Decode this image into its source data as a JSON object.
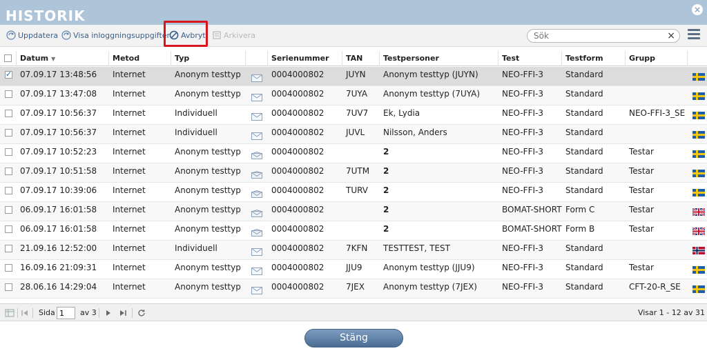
{
  "window": {
    "title": "HISTORIK"
  },
  "toolbar": {
    "update": "Uppdatera",
    "show_login": "Visa inloggningsuppgifter",
    "cancel": "Avbryt",
    "archive": "Arkivera",
    "search_placeholder": "Sök"
  },
  "table": {
    "columns": [
      "Datum",
      "Metod",
      "Typ",
      "",
      "Serienummer",
      "TAN",
      "Testpersoner",
      "Test",
      "Testform",
      "Grupp"
    ],
    "rows": [
      {
        "datum": "07.09.17 13:48:56",
        "metod": "Internet",
        "typ": "Anonym testtyp",
        "serie": "0004000802",
        "tan": "JUYN",
        "person": "Anonym testtyp (JUYN)",
        "test": "NEO-FFI-3",
        "form": "Standard",
        "grupp": "",
        "flag": "se",
        "checked": true
      },
      {
        "datum": "07.09.17 13:47:08",
        "metod": "Internet",
        "typ": "Anonym testtyp",
        "serie": "0004000802",
        "tan": "7UYA",
        "person": "Anonym testtyp (7UYA)",
        "test": "NEO-FFI-3",
        "form": "Standard",
        "grupp": "",
        "flag": "se"
      },
      {
        "datum": "07.09.17 10:56:37",
        "metod": "Internet",
        "typ": "Individuell",
        "serie": "0004000802",
        "tan": "7UV7",
        "person": "Ek, Lydia",
        "test": "NEO-FFI-3",
        "form": "Standard",
        "grupp": "NEO-FFI-3_SE",
        "flag": "se"
      },
      {
        "datum": "07.09.17 10:56:37",
        "metod": "Internet",
        "typ": "Individuell",
        "serie": "0004000802",
        "tan": "JUVL",
        "person": "Nilsson, Anders",
        "test": "NEO-FFI-3",
        "form": "Standard",
        "grupp": "",
        "flag": "se"
      },
      {
        "datum": "07.09.17 10:52:23",
        "metod": "Internet",
        "typ": "Anonym testtyp",
        "serie": "0004000802",
        "tan": "",
        "person": "2",
        "test": "NEO-FFI-3",
        "form": "Standard",
        "grupp": "Testar",
        "flag": "se"
      },
      {
        "datum": "07.09.17 10:51:58",
        "metod": "Internet",
        "typ": "Anonym testtyp",
        "serie": "0004000802",
        "tan": "7UTM",
        "person": "2",
        "test": "NEO-FFI-3",
        "form": "Standard",
        "grupp": "Testar",
        "flag": "se"
      },
      {
        "datum": "07.09.17 10:39:06",
        "metod": "Internet",
        "typ": "Anonym testtyp",
        "serie": "0004000802",
        "tan": "TURV",
        "person": "2",
        "test": "NEO-FFI-3",
        "form": "Standard",
        "grupp": "Testar",
        "flag": "se"
      },
      {
        "datum": "06.09.17 16:01:58",
        "metod": "Internet",
        "typ": "Anonym testtyp",
        "serie": "0004000802",
        "tan": "",
        "person": "2",
        "test": "BOMAT-SHORT",
        "form": "Form C",
        "grupp": "Testar",
        "flag": "uk"
      },
      {
        "datum": "06.09.17 16:01:58",
        "metod": "Internet",
        "typ": "Anonym testtyp",
        "serie": "0004000802",
        "tan": "",
        "person": "2",
        "test": "BOMAT-SHORT",
        "form": "Form B",
        "grupp": "Testar",
        "flag": "uk"
      },
      {
        "datum": "21.09.16 12:52:00",
        "metod": "Internet",
        "typ": "Individuell",
        "serie": "0004000802",
        "tan": "7KFN",
        "person": "TESTTEST, TEST",
        "test": "NEO-FFI-3",
        "form": "Standard",
        "grupp": "",
        "flag": "no"
      },
      {
        "datum": "16.09.16 21:09:31",
        "metod": "Internet",
        "typ": "Anonym testtyp",
        "serie": "0004000802",
        "tan": "JJU9",
        "person": "Anonym testtyp (JJU9)",
        "test": "NEO-FFI-3",
        "form": "Standard",
        "grupp": "Testar",
        "flag": "se"
      },
      {
        "datum": "28.06.16 14:29:04",
        "metod": "Internet",
        "typ": "Anonym testtyp",
        "serie": "0004000802",
        "tan": "7JEX",
        "person": "Anonym testtyp (7JEX)",
        "test": "NEO-FFI-3",
        "form": "Standard",
        "grupp": "CFT-20-R_SE",
        "flag": "se"
      }
    ]
  },
  "pager": {
    "page_label": "Sida",
    "page_value": "1",
    "of_label": "av 3",
    "summary": "Visar 1 - 12 av 31"
  },
  "footer": {
    "close": "Stäng"
  },
  "colors": {
    "titlebar": "#aec4d9",
    "accent": "#3a5f8a",
    "highlight": "#d9141a"
  }
}
